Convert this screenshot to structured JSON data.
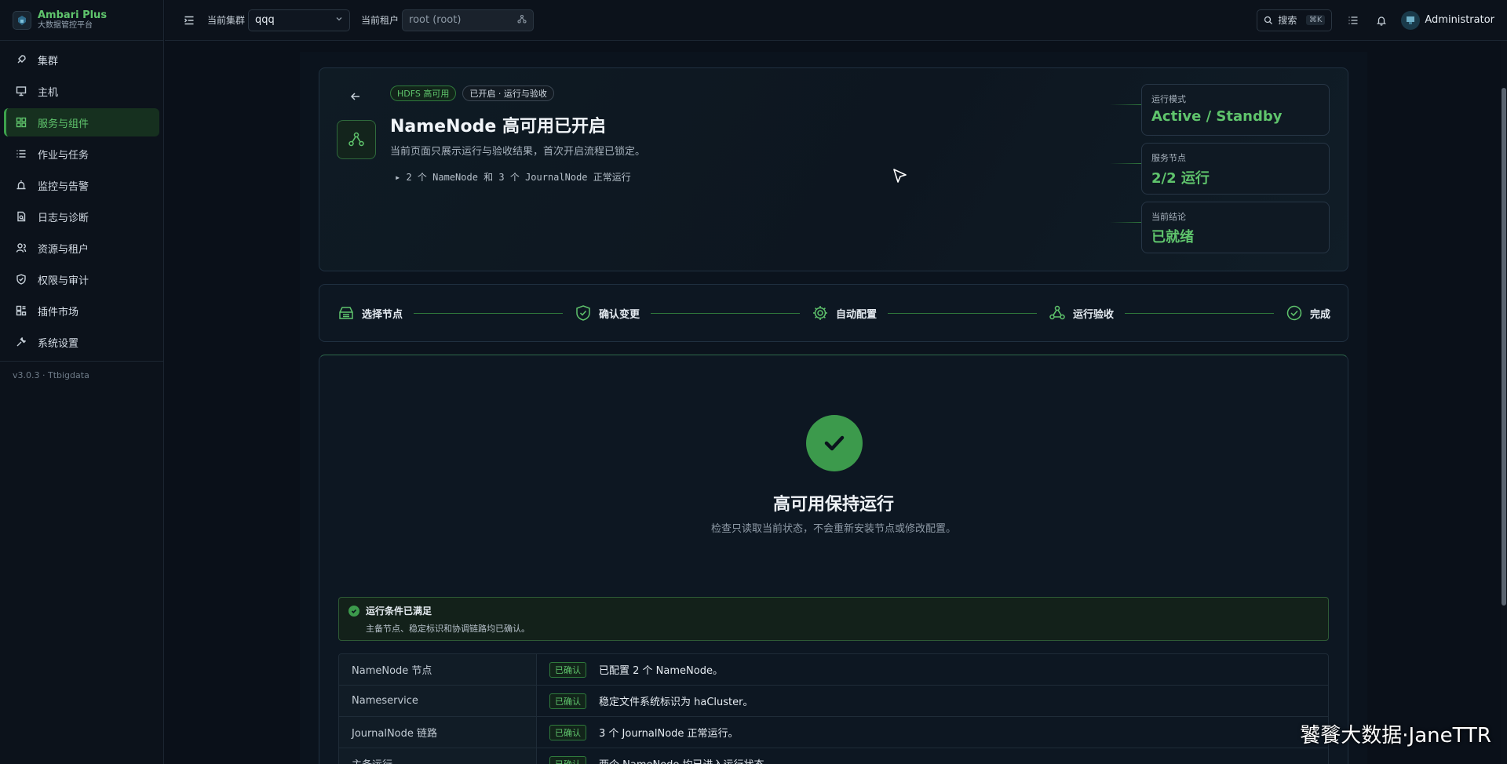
{
  "brand": {
    "name": "Ambari Plus",
    "subtitle": "大数据管控平台"
  },
  "sidebar": {
    "items": [
      {
        "label": "集群",
        "icon": "rocket-icon"
      },
      {
        "label": "主机",
        "icon": "monitor-icon"
      },
      {
        "label": "服务与组件",
        "icon": "grid-icon",
        "active": true
      },
      {
        "label": "作业与任务",
        "icon": "list-icon"
      },
      {
        "label": "监控与告警",
        "icon": "alarm-icon"
      },
      {
        "label": "日志与诊断",
        "icon": "file-search-icon"
      },
      {
        "label": "资源与租户",
        "icon": "users-icon"
      },
      {
        "label": "权限与审计",
        "icon": "shield-icon"
      },
      {
        "label": "插件市场",
        "icon": "plugin-icon"
      },
      {
        "label": "系统设置",
        "icon": "wrench-icon"
      }
    ],
    "version": "v3.0.3 · Ttbigdata"
  },
  "topbar": {
    "cluster_label": "当前集群",
    "cluster_value": "qqq",
    "tenant_label": "当前租户",
    "tenant_value": "root (root)",
    "search_label": "搜索",
    "search_shortcut": "⌘K",
    "user": "Administrator"
  },
  "hero": {
    "tags": [
      "HDFS 高可用",
      "已开启 · 运行与验收"
    ],
    "title": "NameNode 高可用已开启",
    "subtitle": "当前页面只展示运行与验收结果，首次开启流程已锁定。",
    "detail": "2 个 NameNode 和 3 个 JournalNode 正常运行",
    "stats": [
      {
        "label": "运行模式",
        "value": "Active / Standby"
      },
      {
        "label": "服务节点",
        "value": "2/2 运行"
      },
      {
        "label": "当前结论",
        "value": "已就绪"
      }
    ]
  },
  "steps": [
    {
      "label": "选择节点",
      "icon": "server-icon"
    },
    {
      "label": "确认变更",
      "icon": "shield-check-icon"
    },
    {
      "label": "自动配置",
      "icon": "gear-icon"
    },
    {
      "label": "运行验收",
      "icon": "cluster-icon"
    },
    {
      "label": "完成",
      "icon": "check-circle-icon"
    }
  ],
  "result": {
    "title": "高可用保持运行",
    "subtitle": "检查只读取当前状态，不会重新安装节点或修改配置。",
    "alert_title": "运行条件已满足",
    "alert_desc": "主备节点、稳定标识和协调链路均已确认。",
    "rows": [
      {
        "key": "NameNode 节点",
        "badge": "已确认",
        "value": "已配置 2 个 NameNode。"
      },
      {
        "key": "Nameservice",
        "badge": "已确认",
        "value": "稳定文件系统标识为 haCluster。"
      },
      {
        "key": "JournalNode 链路",
        "badge": "已确认",
        "value": "3 个 JournalNode 正常运行。"
      },
      {
        "key": "主备运行",
        "badge": "已确认",
        "value": "两个 NameNode 均已进入运行状态。"
      }
    ]
  },
  "watermark": "饕餮大数据·JaneTTR",
  "colors": {
    "accent": "#5fc46c",
    "background": "#0a1019",
    "success": "#3c9a4c"
  }
}
